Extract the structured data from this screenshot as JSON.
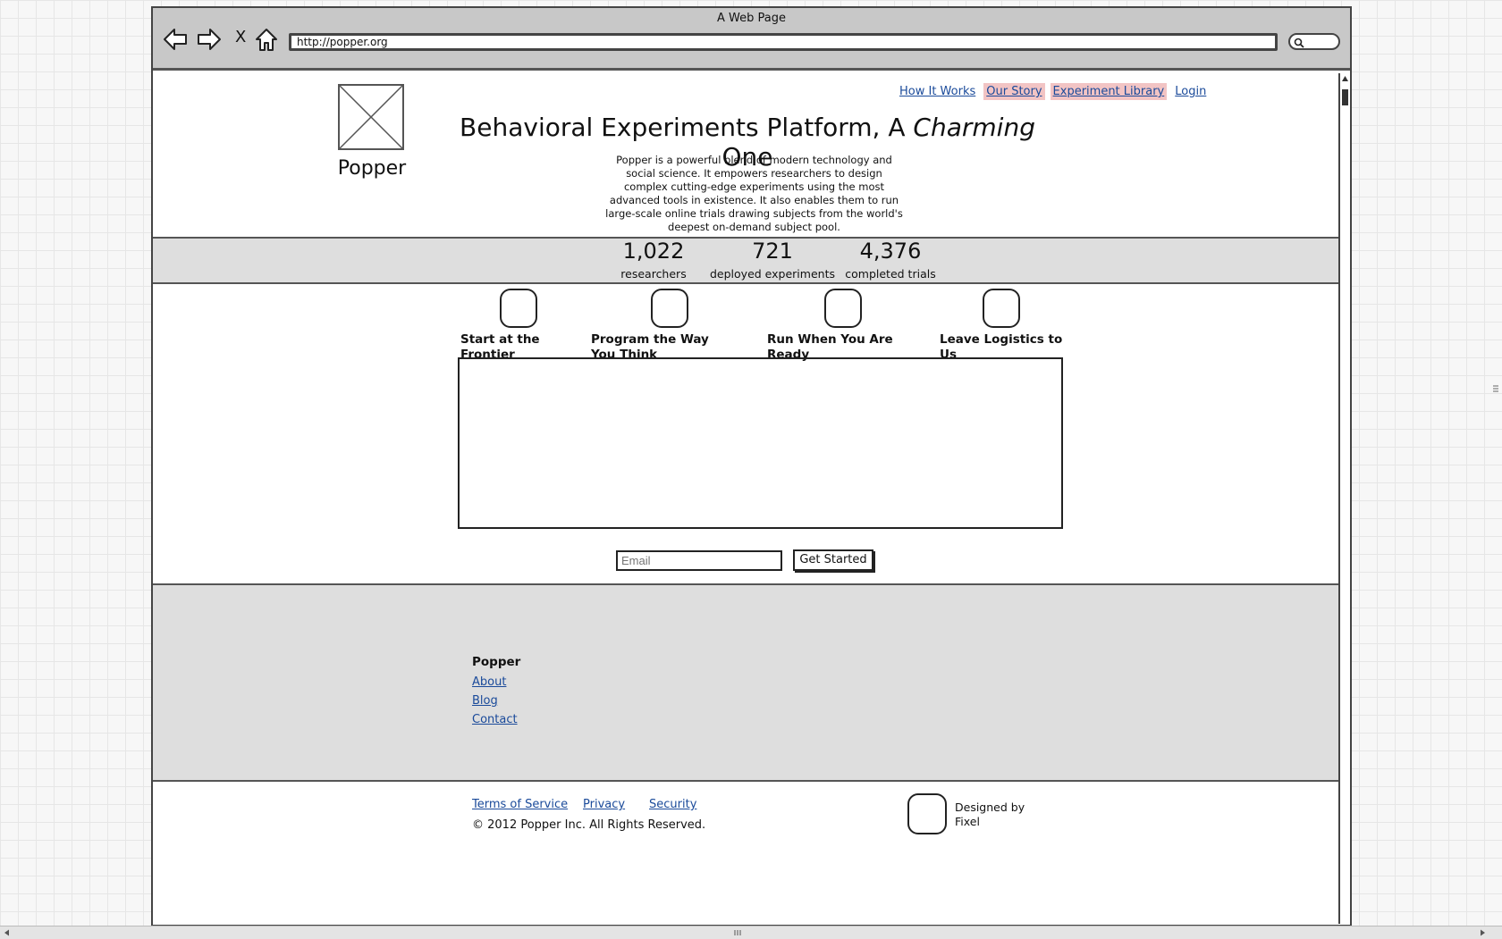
{
  "window": {
    "title": "A Web Page",
    "url": "http://popper.org",
    "close_glyph": "X"
  },
  "nav": [
    {
      "label": "How It Works",
      "highlight": false
    },
    {
      "label": "Our Story",
      "highlight": true
    },
    {
      "label": "Experiment Library",
      "highlight": true
    },
    {
      "label": "Login",
      "highlight": false
    }
  ],
  "brand": {
    "name": "Popper"
  },
  "hero": {
    "headline_pre": "Behavioral Experiments Platform, A ",
    "headline_em": "Charming",
    "headline_post": " One",
    "intro": "Popper is a powerful blend of modern technology and social science. It empowers researchers to design complex cutting-edge experiments using the most advanced tools in existence. It also enables them to run large-scale online trials drawing subjects from the world's deepest on-demand subject pool."
  },
  "stats": [
    {
      "value": "1,022",
      "label": "researchers"
    },
    {
      "value": "721",
      "label": "deployed experiments"
    },
    {
      "value": "4,376",
      "label": "completed trials"
    }
  ],
  "features": [
    {
      "title": "Start at the Frontier"
    },
    {
      "title": "Program the Way You Think"
    },
    {
      "title": "Run When You Are Ready"
    },
    {
      "title": "Leave Logistics to Us"
    }
  ],
  "signup": {
    "email_placeholder": "Email",
    "button": "Get Started"
  },
  "footer": {
    "title": "Popper",
    "links": [
      "About",
      "Blog",
      "Contact"
    ],
    "legal": [
      "Terms of Service",
      "Privacy",
      "Security"
    ],
    "copyright": "© 2012 Popper Inc. All Rights Reserved.",
    "designed_by": "Designed by Fixel"
  },
  "colors": {
    "highlight": "#f2c4c4",
    "band": "#dedede",
    "link": "#1a4a9a"
  }
}
